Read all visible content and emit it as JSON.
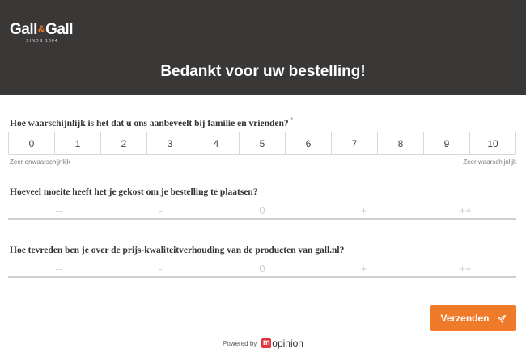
{
  "header": {
    "logo_text_left": "Gall",
    "logo_amp": "&",
    "logo_text_right": "Gall",
    "logo_subtext": "SINDS 1884",
    "title": "Bedankt voor uw bestelling!",
    "background_color": "#3a3737"
  },
  "question1": {
    "label": "Hoe waarschijnlijk is het dat u ons aanbeveelt bij familie en vrienden?",
    "required_mark": "*",
    "options": [
      "0",
      "1",
      "2",
      "3",
      "4",
      "5",
      "6",
      "7",
      "8",
      "9",
      "10"
    ],
    "low_label": "Zeer onwaarschijnlijk",
    "high_label": "Zeer waarschijnlijk"
  },
  "question2": {
    "label": "Hoeveel moeite heeft het je gekost om je bestelling te plaatsen?",
    "options": [
      "--",
      "-",
      "0",
      "+",
      "++"
    ]
  },
  "question3": {
    "label": "Hoe tevreden ben je over de prijs-kwaliteitverhouding van de producten van gall.nl?",
    "options": [
      "--",
      "-",
      "0",
      "+",
      "++"
    ]
  },
  "submit": {
    "label": "Verzenden",
    "icon": "send-icon",
    "color": "#ef7a2a"
  },
  "footer": {
    "powered_by": "Powered by",
    "brand_m": "m",
    "brand_rest": "opinion",
    "brand_color": "#e2333c"
  }
}
